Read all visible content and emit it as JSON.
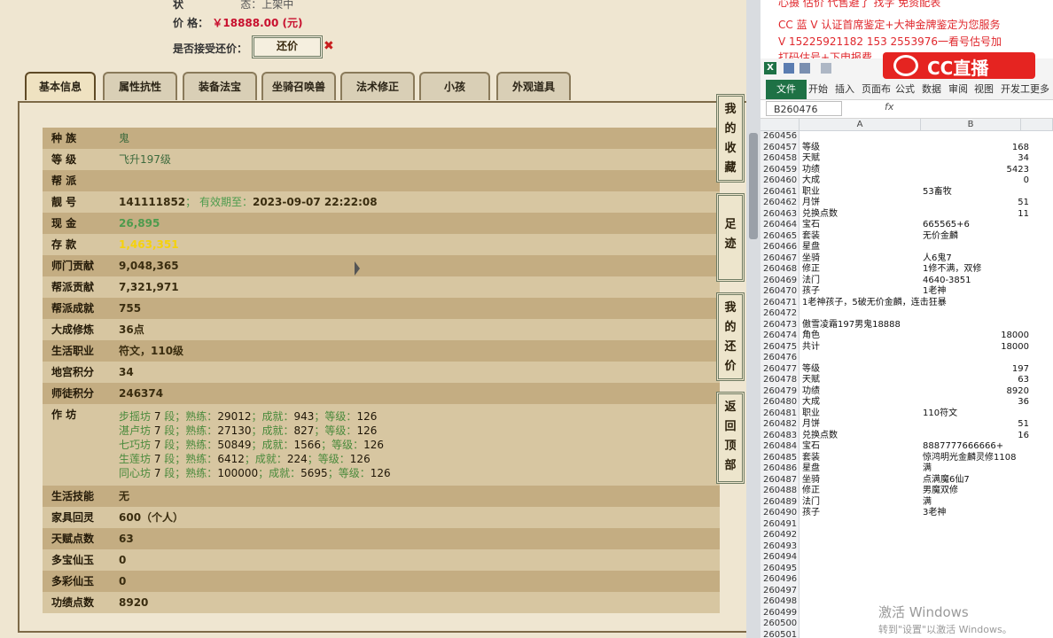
{
  "game": {
    "status_label": "状",
    "status_value": "态：上架中",
    "price_label": "价        格：",
    "price_value": "￥18888.00 (元)",
    "bargain_label": "是否接受还价：",
    "bargain_button": "还价",
    "bargain_x": "✖",
    "tabs": [
      "基本信息",
      "属性抗性",
      "装备法宝",
      "坐骑召唤兽",
      "法术修正",
      "小孩",
      "外观道具"
    ],
    "side_buttons": [
      "我的收藏",
      "足迹",
      "我的还价",
      "返回顶部"
    ],
    "rows": [
      {
        "label": "种    族",
        "value": "鬼",
        "style": "small"
      },
      {
        "label": "等    级",
        "value": "飞升197级",
        "style": "small"
      },
      {
        "label": "帮    派",
        "value": "",
        "style": ""
      },
      {
        "label": "靓    号",
        "value": "141111852",
        "extra_label": "；  有效期至：",
        "extra_value": "2023-09-07 22:22:08",
        "style": ""
      },
      {
        "label": "现    金",
        "value": "26,895",
        "style": "green"
      },
      {
        "label": "存    款",
        "value": "1,463,351",
        "style": "yellow"
      },
      {
        "label": "师门贡献",
        "value": "9,048,365",
        "style": ""
      },
      {
        "label": "帮派贡献",
        "value": "7,321,971",
        "style": ""
      },
      {
        "label": "帮派成就",
        "value": "755",
        "style": ""
      },
      {
        "label": "大成修炼",
        "value": "36点",
        "style": ""
      },
      {
        "label": "生活职业",
        "value": "符文，110级",
        "style": ""
      },
      {
        "label": "地宫积分",
        "value": "34",
        "style": ""
      },
      {
        "label": "师徒积分",
        "value": "246374",
        "style": ""
      }
    ],
    "workshop_label": "作    坊",
    "workshop_lines": [
      {
        "name": "步摇坊",
        "seg": "7",
        "prof": "29012",
        "ach": "943",
        "lvl": "126"
      },
      {
        "name": "湛卢坊",
        "seg": "7",
        "prof": "27130",
        "ach": "827",
        "lvl": "126"
      },
      {
        "name": "七巧坊",
        "seg": "7",
        "prof": "50849",
        "ach": "1566",
        "lvl": "126"
      },
      {
        "name": "生莲坊",
        "seg": "7",
        "prof": "6412",
        "ach": "224",
        "lvl": "126"
      },
      {
        "name": "同心坊",
        "seg": "7",
        "prof": "100000",
        "ach": "5695",
        "lvl": "126"
      }
    ],
    "rows2": [
      {
        "label": "生活技能",
        "value": "无"
      },
      {
        "label": "家具回灵",
        "value": "600（个人）"
      },
      {
        "label": "天赋点数",
        "value": "63"
      },
      {
        "label": "多宝仙玉",
        "value": "0"
      },
      {
        "label": "多彩仙玉",
        "value": "0"
      },
      {
        "label": "功绩点数",
        "value": "8920"
      }
    ]
  },
  "excel": {
    "ad_lines": [
      "认证首席鉴定+大神金牌鉴定为您服务",
      "V 15225921182      153 2553976一看号估号加"
    ],
    "ad_line3": "打码估号+下申报费",
    "banner": "CC直播",
    "menu": [
      "文件",
      "开始",
      "插入",
      "页面布",
      "公式",
      "数据",
      "审阅",
      "视图",
      "开发工",
      "更多"
    ],
    "namebox": "B260476",
    "fx": "fx",
    "col_a": "A",
    "col_b": "B",
    "rows": [
      {
        "n": "260456",
        "a": "",
        "b": ""
      },
      {
        "n": "260457",
        "a": "等级",
        "b": "168",
        "num": true
      },
      {
        "n": "260458",
        "a": "天赋",
        "b": "34",
        "num": true
      },
      {
        "n": "260459",
        "a": "功绩",
        "b": "5423",
        "num": true
      },
      {
        "n": "260460",
        "a": "大成",
        "b": "0",
        "num": true
      },
      {
        "n": "260461",
        "a": "职业",
        "b": "53畜牧"
      },
      {
        "n": "260462",
        "a": "月饼",
        "b": "51",
        "num": true
      },
      {
        "n": "260463",
        "a": "兑换点数",
        "b": "11",
        "num": true
      },
      {
        "n": "260464",
        "a": "宝石",
        "b": "665565+6"
      },
      {
        "n": "260465",
        "a": "套装",
        "b": "无价金麟"
      },
      {
        "n": "260466",
        "a": "星盘",
        "b": ""
      },
      {
        "n": "260467",
        "a": "坐骑",
        "b": "人6鬼7"
      },
      {
        "n": "260468",
        "a": "修正",
        "b": "1修不满，双修"
      },
      {
        "n": "260469",
        "a": "法门",
        "b": "4640-3851"
      },
      {
        "n": "260470",
        "a": "孩子",
        "b": "1老神"
      },
      {
        "n": "260471",
        "a": "1老神孩子，5破无价金麟，连击狂暴",
        "b": ""
      },
      {
        "n": "260472",
        "a": "",
        "b": ""
      },
      {
        "n": "260473",
        "a": "傲雪凌霜197男鬼18888",
        "b": ""
      },
      {
        "n": "260474",
        "a": "角色",
        "b": "18000",
        "num": true
      },
      {
        "n": "260475",
        "a": "共计",
        "b": "18000",
        "num": true
      },
      {
        "n": "260476",
        "a": "",
        "b": ""
      },
      {
        "n": "260477",
        "a": "等级",
        "b": "197",
        "num": true
      },
      {
        "n": "260478",
        "a": "天赋",
        "b": "63",
        "num": true
      },
      {
        "n": "260479",
        "a": "功绩",
        "b": "8920",
        "num": true
      },
      {
        "n": "260480",
        "a": "大成",
        "b": "36",
        "num": true
      },
      {
        "n": "260481",
        "a": "职业",
        "b": "110符文"
      },
      {
        "n": "260482",
        "a": "月饼",
        "b": "51",
        "num": true
      },
      {
        "n": "260483",
        "a": "兑换点数",
        "b": "16",
        "num": true
      },
      {
        "n": "260484",
        "a": "宝石",
        "b": "8887777666666+"
      },
      {
        "n": "260485",
        "a": "套装",
        "b": "惊鸿明光金麟灵修1108"
      },
      {
        "n": "260486",
        "a": "星盘",
        "b": "满"
      },
      {
        "n": "260487",
        "a": "坐骑",
        "b": "点满魔6仙7"
      },
      {
        "n": "260488",
        "a": "修正",
        "b": "男魔双修"
      },
      {
        "n": "260489",
        "a": "法门",
        "b": "满"
      },
      {
        "n": "260490",
        "a": "孩子",
        "b": "3老神"
      },
      {
        "n": "260491",
        "a": "",
        "b": ""
      },
      {
        "n": "260492",
        "a": "",
        "b": ""
      },
      {
        "n": "260493",
        "a": "",
        "b": ""
      },
      {
        "n": "260494",
        "a": "",
        "b": ""
      },
      {
        "n": "260495",
        "a": "",
        "b": ""
      },
      {
        "n": "260496",
        "a": "",
        "b": ""
      },
      {
        "n": "260497",
        "a": "",
        "b": ""
      },
      {
        "n": "260498",
        "a": "",
        "b": ""
      },
      {
        "n": "260499",
        "a": "",
        "b": ""
      },
      {
        "n": "260500",
        "a": "",
        "b": ""
      },
      {
        "n": "260501",
        "a": "",
        "b": ""
      }
    ],
    "activate_title": "激活 Windows",
    "activate_sub": "转到\"设置\"以激活 Windows。"
  }
}
